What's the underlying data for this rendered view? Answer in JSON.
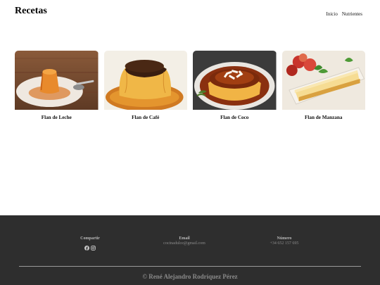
{
  "header": {
    "title": "Recetas",
    "nav": [
      {
        "label": "Inicio"
      },
      {
        "label": "Nutrientes"
      }
    ]
  },
  "cards": [
    {
      "title": "Flan de Leche"
    },
    {
      "title": "Flan de Café"
    },
    {
      "title": "Flan de Coco"
    },
    {
      "title": "Flan de Manzana"
    }
  ],
  "footer": {
    "share_label": "Compartir",
    "social_icons": [
      "facebook-icon",
      "instagram-icon"
    ],
    "email_label": "Email",
    "email_value": "cocinadulce@gmail.com",
    "phone_label": "Número",
    "phone_value": "+34 652 157 695",
    "copyright": "© René Alejandro Rodríquez Pérez"
  },
  "colors": {
    "footer_bg": "#2e2e2e",
    "caramel": "#c86a1e",
    "custard": "#f2b548"
  }
}
